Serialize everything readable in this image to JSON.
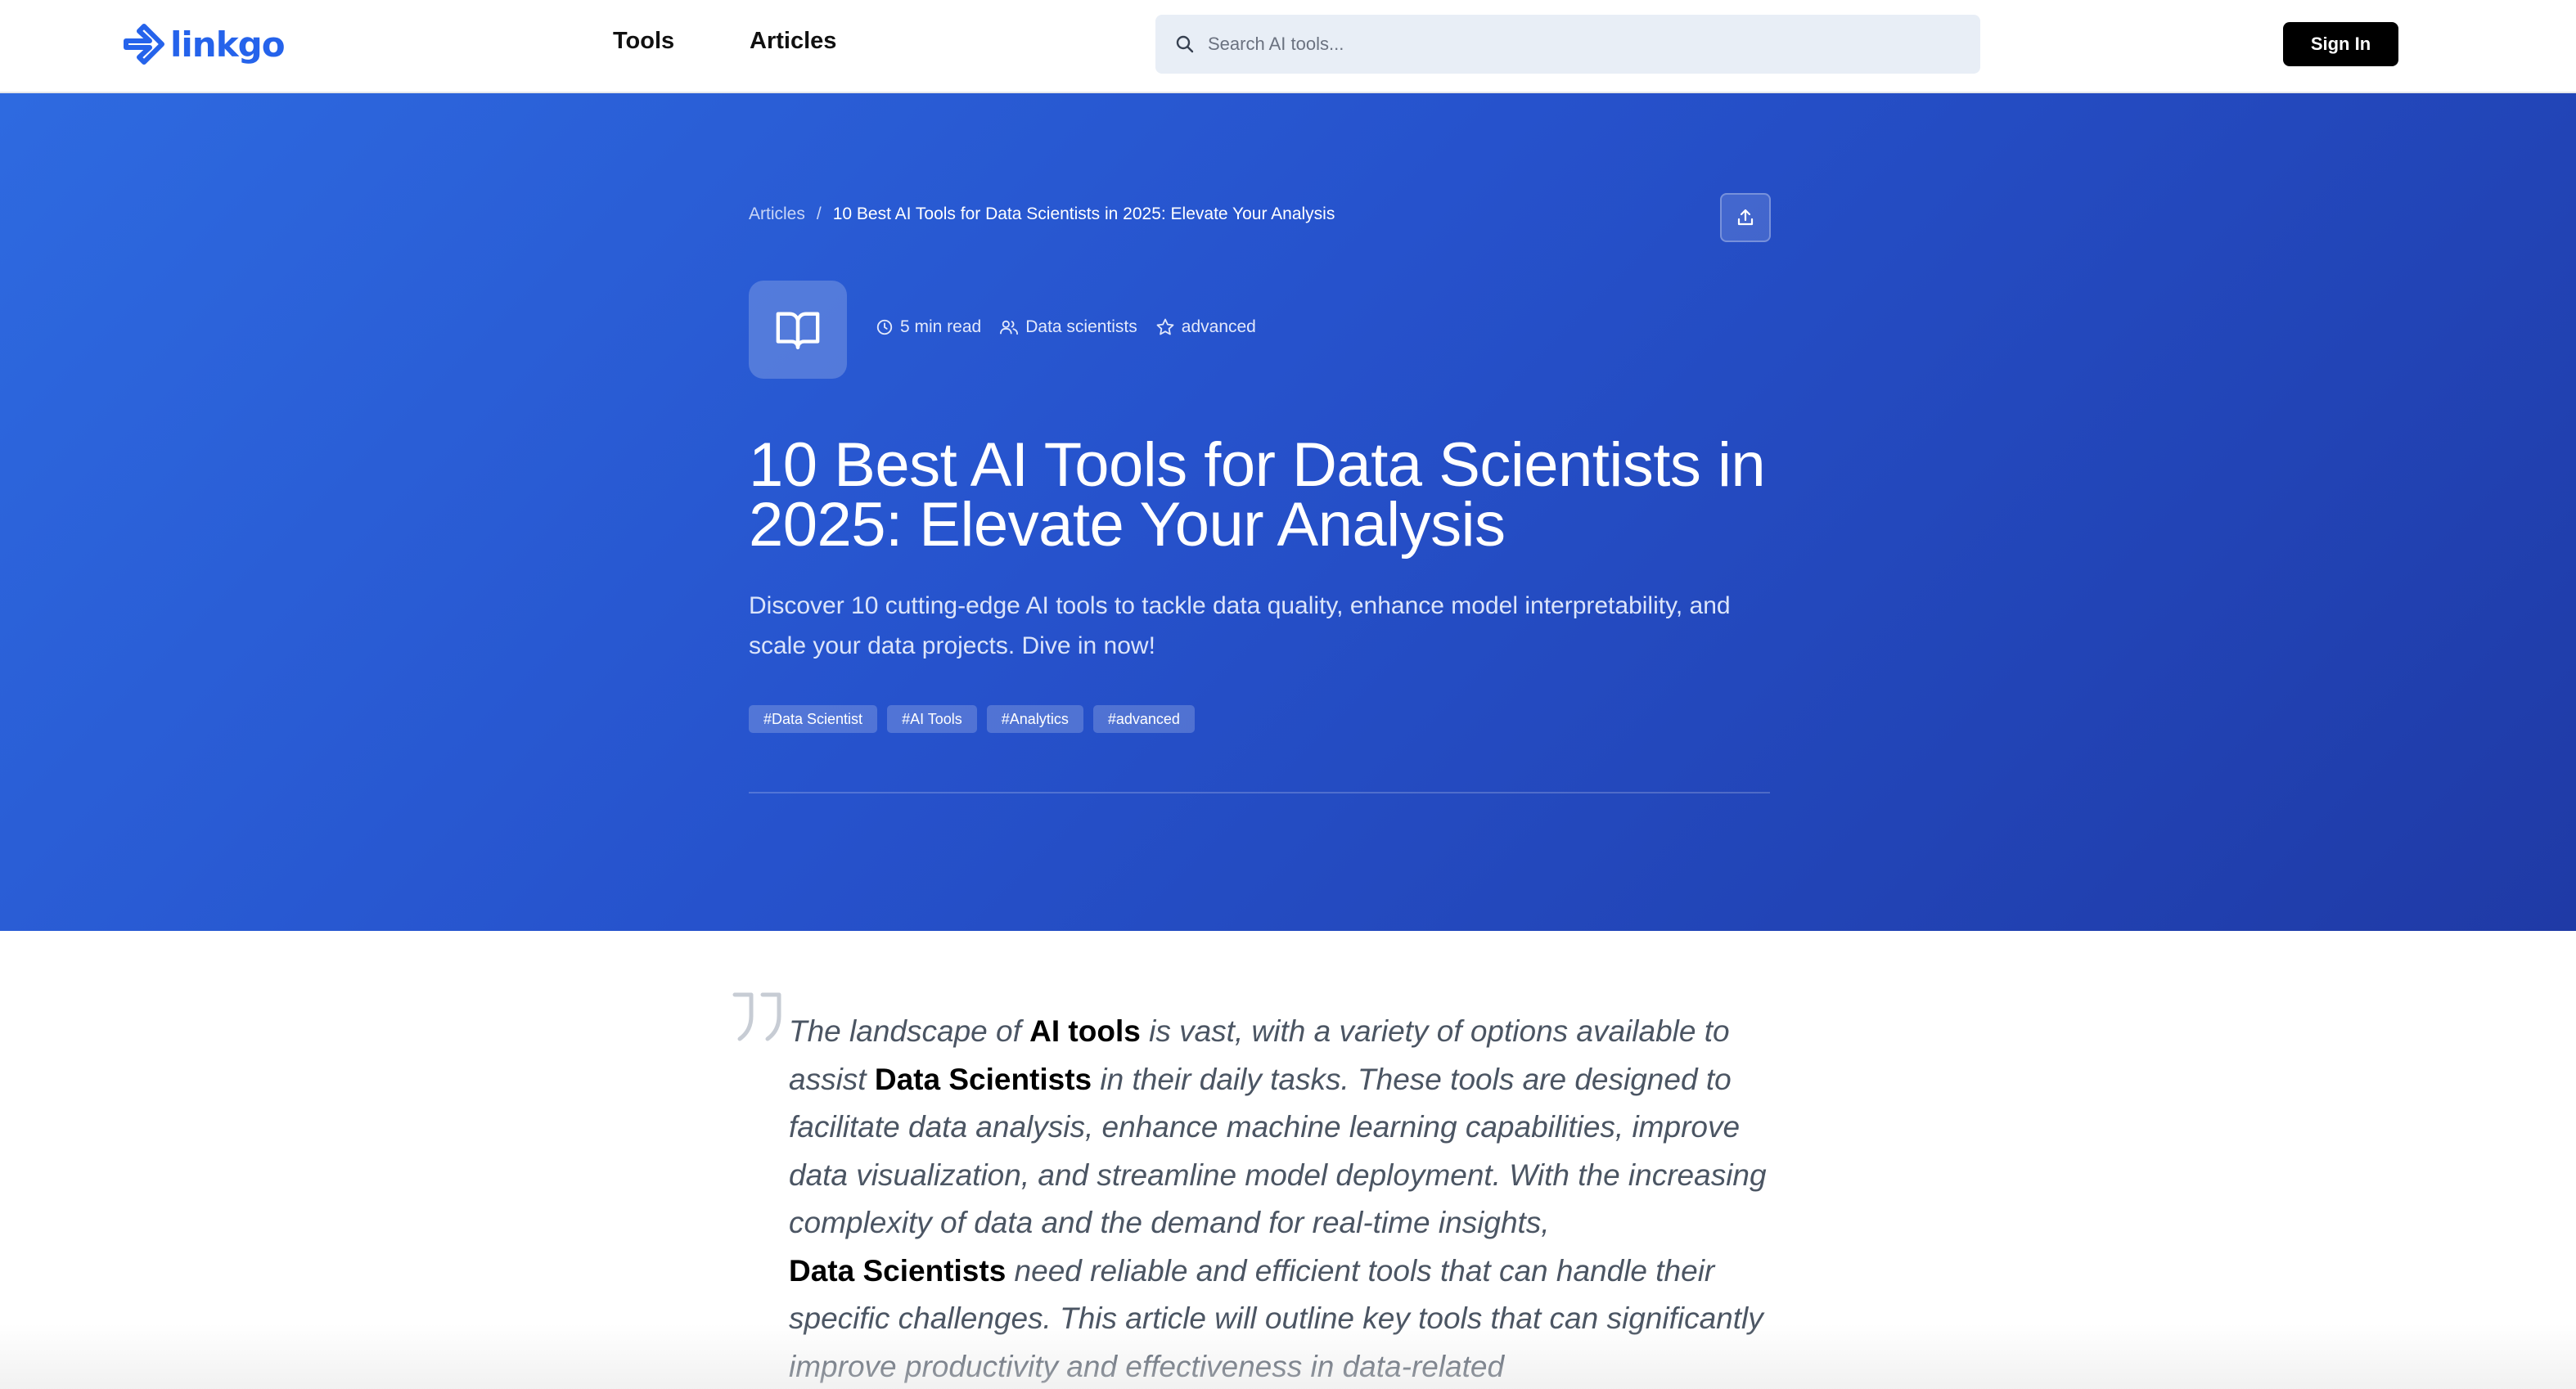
{
  "header": {
    "logo_text": "linkgo",
    "nav": [
      {
        "label": "Tools"
      },
      {
        "label": "Articles"
      }
    ],
    "search_placeholder": "Search AI tools...",
    "signin_label": "Sign In"
  },
  "hero": {
    "breadcrumb": {
      "root": "Articles",
      "separator": "/",
      "current": "10 Best AI Tools for Data Scientists in 2025: Elevate Your Analysis"
    },
    "meta": {
      "read_time": "5 min read",
      "audience": "Data scientists",
      "level": "advanced"
    },
    "title": "10 Best AI Tools for Data Scientists in 2025: Elevate Your Analysis",
    "subtitle": "Discover 10 cutting-edge AI tools to tackle data quality, enhance model interpretability, and scale your data projects. Dive in now!",
    "tags": [
      "#Data Scientist",
      "#AI Tools",
      "#Analytics",
      "#advanced"
    ]
  },
  "article": {
    "quote_parts": [
      {
        "text": "The landscape of ",
        "bold": false
      },
      {
        "text": "AI tools",
        "bold": true
      },
      {
        "text": " is vast, with a variety of options available to assist ",
        "bold": false
      },
      {
        "text": "Data Scientists",
        "bold": true
      },
      {
        "text": " in their daily tasks. These tools are designed to facilitate data analysis, enhance machine learning capabilities, improve data visualization, and streamline model deployment. With the increasing complexity of data and the demand for real-time insights, ",
        "bold": false
      },
      {
        "text": "Data Scientists",
        "bold": true
      },
      {
        "text": " need reliable and efficient tools that can handle their specific challenges. This article will outline key tools that can significantly improve productivity and effectiveness in data-related",
        "bold": false
      }
    ]
  },
  "colors": {
    "brand": "#2563eb",
    "hero_start": "#2e6ae0",
    "hero_end": "#1f3aa6"
  }
}
